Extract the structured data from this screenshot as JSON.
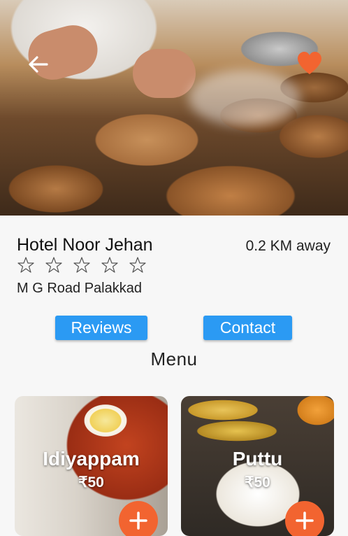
{
  "restaurant": {
    "name": "Hotel Noor Jehan",
    "distance": "0.2 KM away",
    "address": "M G Road Palakkad",
    "rating": 0,
    "rating_max": 5
  },
  "actions": {
    "reviews_label": "Reviews",
    "contact_label": "Contact"
  },
  "menu": {
    "title": "Menu",
    "items": [
      {
        "name": "Idiyappam",
        "price": "₹50"
      },
      {
        "name": "Puttu",
        "price": "₹50"
      }
    ]
  },
  "icons": {
    "back": "arrow-left-icon",
    "favorite": "heart-icon",
    "star": "star-outline-icon",
    "add": "plus-icon"
  },
  "colors": {
    "accent_blue": "#2b9af3",
    "favorite_orange": "#f26430",
    "add_orange": "#f26430"
  }
}
